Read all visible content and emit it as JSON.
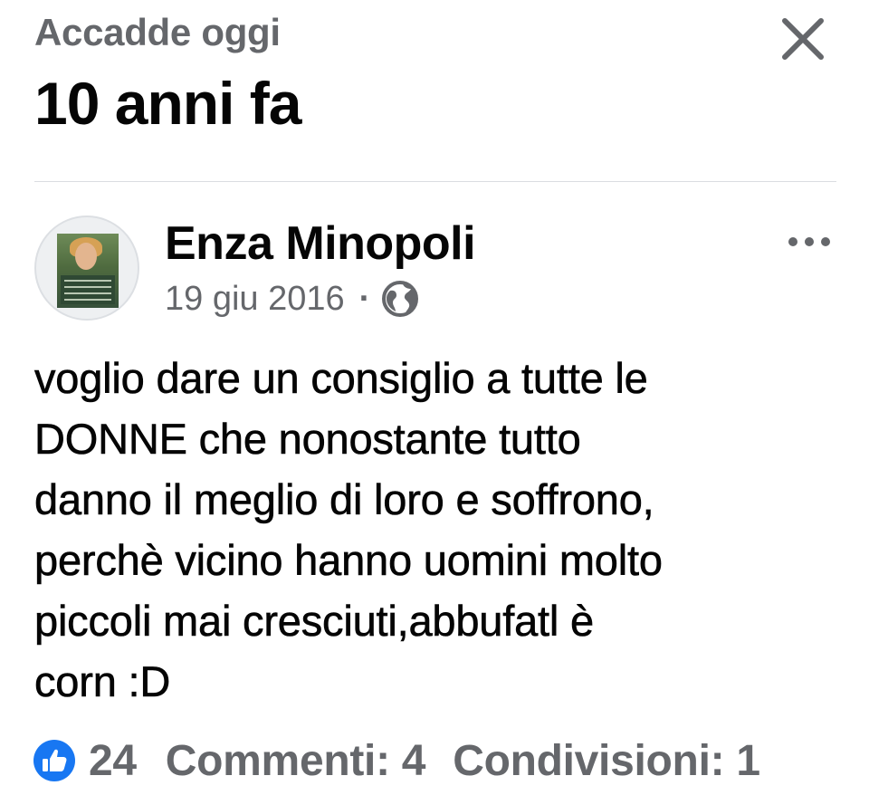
{
  "header": {
    "subtitle": "Accadde oggi",
    "title": "10 anni fa"
  },
  "post": {
    "author": "Enza Minopoli",
    "date": "19 giu 2016",
    "separator": "·",
    "privacy_icon": "globe-icon",
    "text_lines": [
      "voglio dare un consiglio a tutte le",
      "DONNE che nonostante tutto",
      "danno il meglio di loro e soffrono,",
      "perchè vicino hanno uomini molto",
      "piccoli mai cresciuti,abbufatl è",
      "corn :D"
    ]
  },
  "footer": {
    "like_count": "24",
    "comments": "Commenti: 4",
    "shares": "Condivisioni: 1"
  },
  "colors": {
    "primary_text": "#050505",
    "secondary_text": "#65676b",
    "like_blue": "#1877f2",
    "divider": "#dadde1"
  }
}
